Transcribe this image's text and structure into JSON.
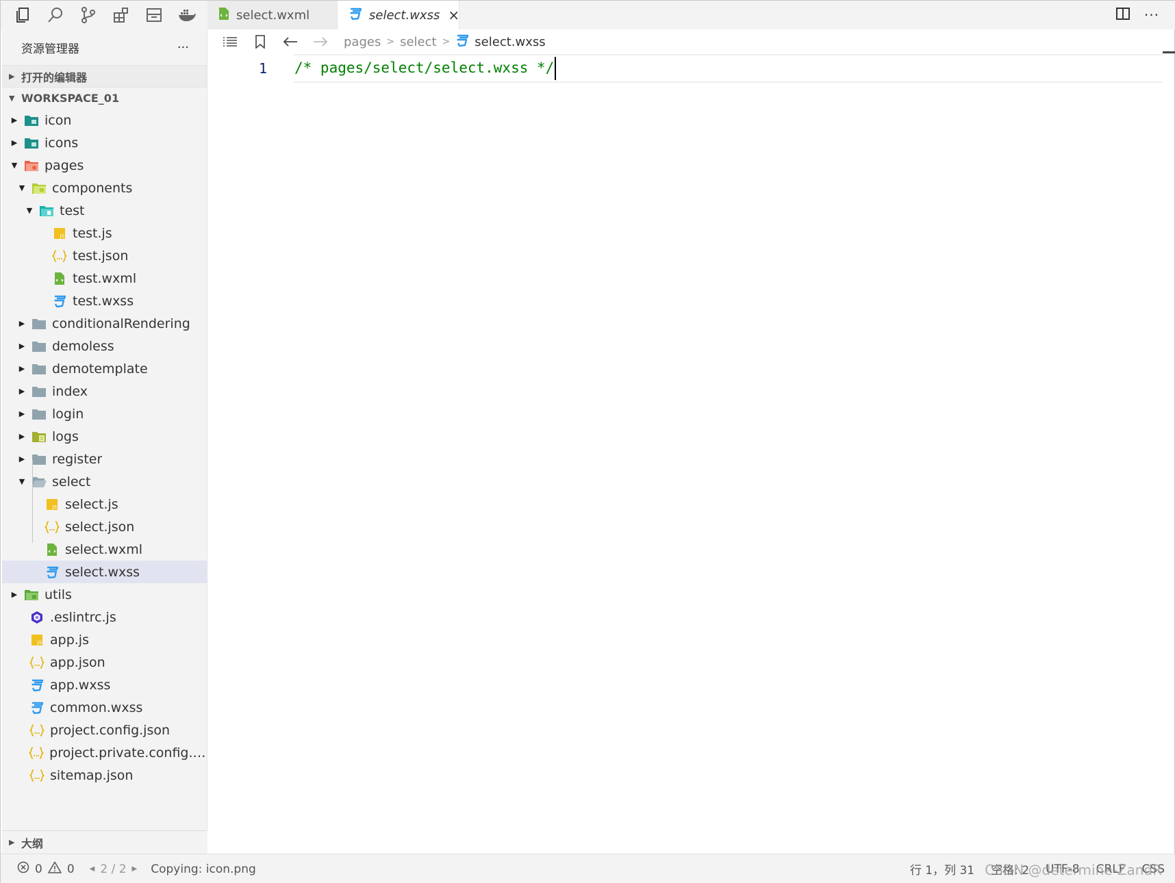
{
  "topbar": {
    "activity_icons": [
      "explorer-icon",
      "search-icon",
      "source-control-icon",
      "extensions-icon",
      "layout-icon",
      "docker-icon"
    ],
    "tabs": [
      {
        "label": "select.wxml",
        "icon": "wxml-file-icon",
        "active": false
      },
      {
        "label": "select.wxss",
        "icon": "wxss-file-icon",
        "active": true,
        "close": "×"
      }
    ],
    "right_icons": [
      "split-editor-icon",
      "more-icon"
    ],
    "more_label": "···"
  },
  "sidebar": {
    "title": "资源管理器",
    "more_label": "···",
    "open_editors": "打开的编辑器",
    "workspace": "WORKSPACE_01",
    "tree": [
      {
        "label": "icon",
        "depth": 0,
        "arrow": "collapsed",
        "icon": "folder-teal"
      },
      {
        "label": "icons",
        "depth": 0,
        "arrow": "collapsed",
        "icon": "folder-teal"
      },
      {
        "label": "pages",
        "depth": 0,
        "arrow": "expanded",
        "icon": "folder-red"
      },
      {
        "label": "components",
        "depth": 1,
        "arrow": "expanded",
        "icon": "folder-lime"
      },
      {
        "label": "test",
        "depth": 2,
        "arrow": "expanded",
        "icon": "folder-cyan"
      },
      {
        "label": "test.js",
        "depth": 3,
        "arrow": "none",
        "icon": "js"
      },
      {
        "label": "test.json",
        "depth": 3,
        "arrow": "none",
        "icon": "json"
      },
      {
        "label": "test.wxml",
        "depth": 3,
        "arrow": "none",
        "icon": "wxml"
      },
      {
        "label": "test.wxss",
        "depth": 3,
        "arrow": "none",
        "icon": "wxss"
      },
      {
        "label": "conditionalRendering",
        "depth": 1,
        "arrow": "collapsed",
        "icon": "folder-gray"
      },
      {
        "label": "demoless",
        "depth": 1,
        "arrow": "collapsed",
        "icon": "folder-gray"
      },
      {
        "label": "demotemplate",
        "depth": 1,
        "arrow": "collapsed",
        "icon": "folder-gray"
      },
      {
        "label": "index",
        "depth": 1,
        "arrow": "collapsed",
        "icon": "folder-gray"
      },
      {
        "label": "login",
        "depth": 1,
        "arrow": "collapsed",
        "icon": "folder-gray"
      },
      {
        "label": "logs",
        "depth": 1,
        "arrow": "collapsed",
        "icon": "folder-olive"
      },
      {
        "label": "register",
        "depth": 1,
        "arrow": "collapsed",
        "icon": "folder-gray"
      },
      {
        "label": "select",
        "depth": 1,
        "arrow": "expanded",
        "icon": "folder-gray-open"
      },
      {
        "label": "select.js",
        "depth": 2,
        "arrow": "none",
        "icon": "js"
      },
      {
        "label": "select.json",
        "depth": 2,
        "arrow": "none",
        "icon": "json"
      },
      {
        "label": "select.wxml",
        "depth": 2,
        "arrow": "none",
        "icon": "wxml"
      },
      {
        "label": "select.wxss",
        "depth": 2,
        "arrow": "none",
        "icon": "wxss",
        "selected": true
      },
      {
        "label": "utils",
        "depth": 0,
        "arrow": "collapsed",
        "icon": "folder-green"
      },
      {
        "label": ".eslintrc.js",
        "depth": 0,
        "arrow": "none",
        "icon": "eslint"
      },
      {
        "label": "app.js",
        "depth": 0,
        "arrow": "none",
        "icon": "js"
      },
      {
        "label": "app.json",
        "depth": 0,
        "arrow": "none",
        "icon": "json"
      },
      {
        "label": "app.wxss",
        "depth": 0,
        "arrow": "none",
        "icon": "wxss"
      },
      {
        "label": "common.wxss",
        "depth": 0,
        "arrow": "none",
        "icon": "wxss"
      },
      {
        "label": "project.config.json",
        "depth": 0,
        "arrow": "none",
        "icon": "json"
      },
      {
        "label": "project.private.config.js...",
        "depth": 0,
        "arrow": "none",
        "icon": "json"
      },
      {
        "label": "sitemap.json",
        "depth": 0,
        "arrow": "none",
        "icon": "json"
      }
    ],
    "outline": "大纲"
  },
  "breadcrumb": {
    "items": [
      "pages",
      "select"
    ],
    "current": "select.wxss"
  },
  "editor": {
    "line_number": "1",
    "code": "/* pages/select/select.wxss */"
  },
  "status": {
    "errors": "0",
    "warnings": "0",
    "pager": "2 / 2",
    "message": "Copying: icon.png",
    "position": "行 1，列 31",
    "spaces": "空格: 2",
    "encoding": "UTF-8",
    "eol": "CRLF",
    "language": "CSS"
  },
  "watermark": "CSDN @determine-ZandR",
  "colors": {
    "comment": "#008000",
    "selected_row": "#e1e4f0",
    "js_icon": "#f0c020",
    "json_icon": "#e2b100",
    "wxml_icon": "#6cb33f",
    "wxss_icon": "#2e9bf0"
  }
}
